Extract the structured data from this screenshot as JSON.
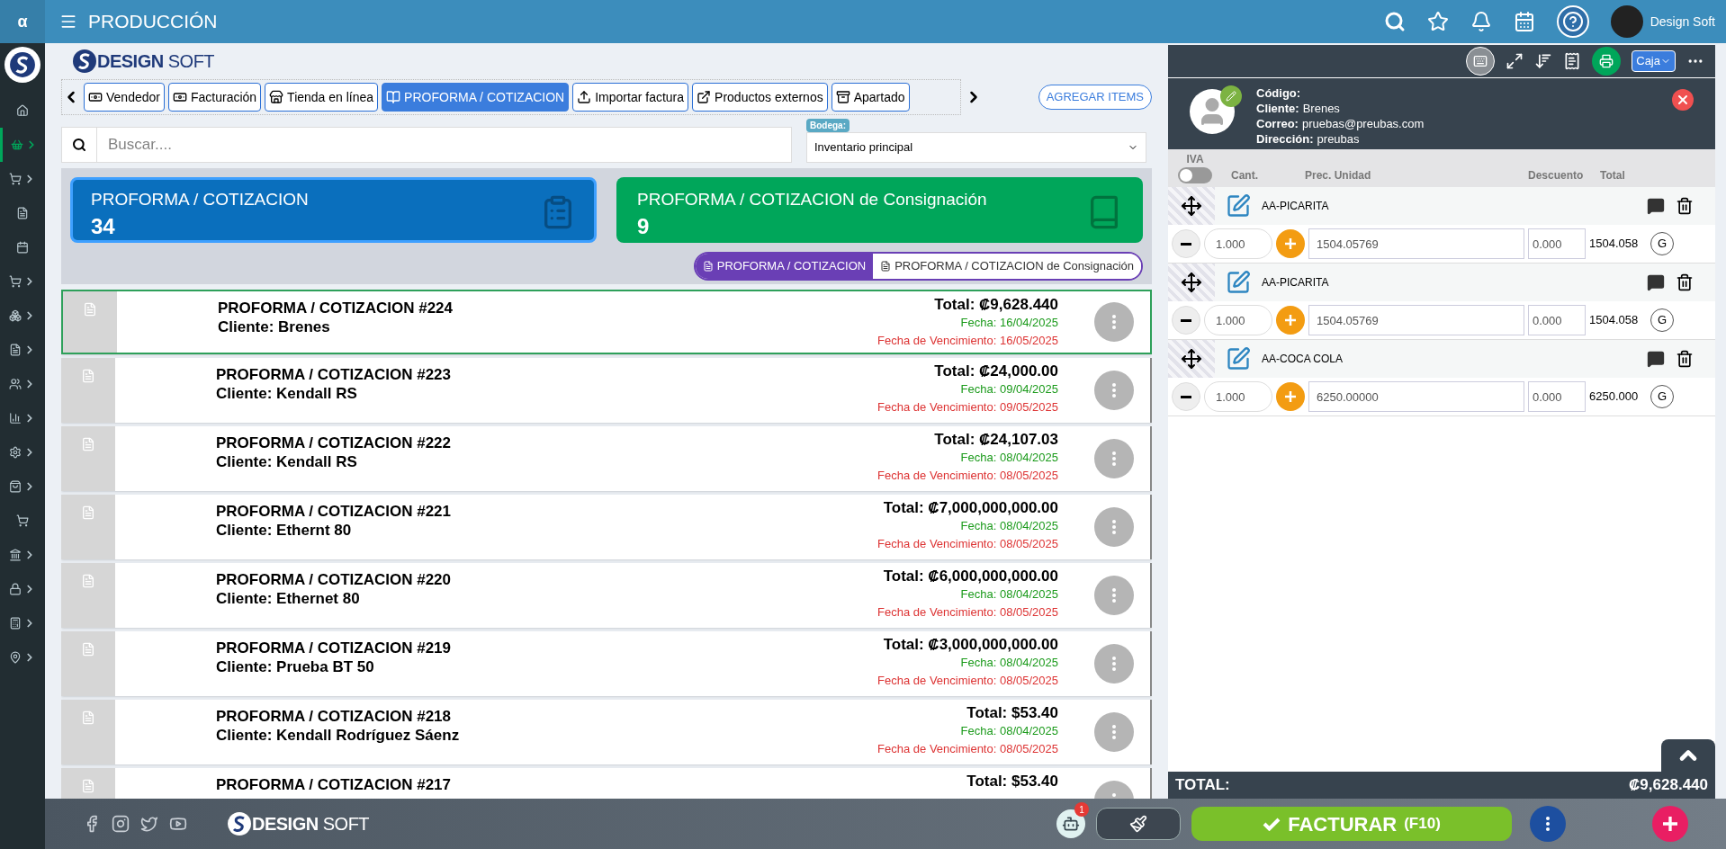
{
  "top_bar": {
    "logo": "α",
    "title": "PRODUCCIÓN",
    "user": "Design Soft"
  },
  "sidebar": {
    "items": [
      {
        "selected": false,
        "expandable": false
      },
      {
        "selected": true,
        "expandable": true
      },
      {
        "selected": false,
        "expandable": true
      },
      {
        "selected": false,
        "expandable": false
      },
      {
        "selected": false,
        "expandable": false
      },
      {
        "selected": false,
        "expandable": true
      },
      {
        "selected": false,
        "expandable": true
      },
      {
        "selected": false,
        "expandable": true
      },
      {
        "selected": false,
        "expandable": true
      },
      {
        "selected": false,
        "expandable": true
      },
      {
        "selected": false,
        "expandable": true
      },
      {
        "selected": false,
        "expandable": true
      },
      {
        "selected": false,
        "expandable": false
      },
      {
        "selected": false,
        "expandable": true
      },
      {
        "selected": false,
        "expandable": true
      },
      {
        "selected": false,
        "expandable": true
      },
      {
        "selected": false,
        "expandable": true
      }
    ]
  },
  "brand": {
    "bold": "DESIGN",
    "light": "SOFT"
  },
  "footer_brand": {
    "bold": "DESIGN",
    "light": "SOFT"
  },
  "tabs": [
    {
      "label": "Vendedor",
      "selected": false
    },
    {
      "label": "Facturación",
      "selected": false
    },
    {
      "label": "Tienda en línea",
      "selected": false
    },
    {
      "label": "PROFORMA / COTIZACION",
      "selected": true
    },
    {
      "label": "Importar factura",
      "selected": false
    },
    {
      "label": "Productos externos",
      "selected": false
    },
    {
      "label": "Apartado",
      "selected": false
    }
  ],
  "add_button": "AGREGAR ITEMS",
  "search": {
    "placeholder": "Buscar...."
  },
  "warehouse": {
    "label": "Bodega:",
    "value": "Inventario principal"
  },
  "summary_cards": [
    {
      "title": "PROFORMA / COTIZACION",
      "count": "34",
      "selected": true,
      "color": "#0a6fbd"
    },
    {
      "title": "PROFORMA / COTIZACION de Consignación",
      "count": "9",
      "selected": false,
      "color": "#00a65a"
    }
  ],
  "view_toggle": [
    {
      "label": "PROFORMA / COTIZACION",
      "selected": true
    },
    {
      "label": "PROFORMA / COTIZACION de Consignación",
      "selected": false
    }
  ],
  "documents": [
    {
      "title": "PROFORMA / COTIZACION #224",
      "client": "Cliente: Brenes",
      "total": "Total: ₡9,628.440",
      "date": "Fecha: 16/04/2025",
      "due": "Fecha de Vencimiento: 16/05/2025",
      "selected": true
    },
    {
      "title": "PROFORMA / COTIZACION #223",
      "client": "Cliente: Kendall RS",
      "total": "Total: ₡24,000.00",
      "date": "Fecha: 09/04/2025",
      "due": "Fecha de Vencimiento: 09/05/2025",
      "selected": false
    },
    {
      "title": "PROFORMA / COTIZACION #222",
      "client": "Cliente: Kendall RS",
      "total": "Total: ₡24,107.03",
      "date": "Fecha: 08/04/2025",
      "due": "Fecha de Vencimiento: 08/05/2025",
      "selected": false
    },
    {
      "title": "PROFORMA / COTIZACION #221",
      "client": "Cliente: Ethernt 80",
      "total": "Total: ₡7,000,000,000.00",
      "date": "Fecha: 08/04/2025",
      "due": "Fecha de Vencimiento: 08/05/2025",
      "selected": false
    },
    {
      "title": "PROFORMA / COTIZACION #220",
      "client": "Cliente: Ethernet 80",
      "total": "Total: ₡6,000,000,000.00",
      "date": "Fecha: 08/04/2025",
      "due": "Fecha de Vencimiento: 08/05/2025",
      "selected": false
    },
    {
      "title": "PROFORMA / COTIZACION #219",
      "client": "Cliente: Prueba BT 50",
      "total": "Total: ₡3,000,000,000.00",
      "date": "Fecha: 08/04/2025",
      "due": "Fecha de Vencimiento: 08/05/2025",
      "selected": false
    },
    {
      "title": "PROFORMA / COTIZACION #218",
      "client": "Cliente: Kendall Rodríguez Sáenz",
      "total": "Total: $53.40",
      "date": "Fecha: 08/04/2025",
      "due": "Fecha de Vencimiento: 08/05/2025",
      "selected": false
    },
    {
      "title": "PROFORMA / COTIZACION #217",
      "total": "Total: $53.40",
      "selected": false
    }
  ],
  "order_panel": {
    "register_button": "Caja",
    "customer": [
      {
        "label": "Código:"
      },
      {
        "label": "Cliente:",
        "value": "Brenes"
      },
      {
        "label": "Correo:",
        "value": "pruebas@preubas.com"
      },
      {
        "label": "Dirección:",
        "value": "preubas"
      }
    ],
    "iva": {
      "label": "IVA",
      "on": false
    },
    "columns": [
      "Cant.",
      "Prec. Unidad",
      "Descuento",
      "Total"
    ],
    "items": [
      {
        "name": "AA-PICARITA",
        "quantity": "1.000",
        "unit_price": "1504.05769",
        "discount": "0.000",
        "total": "1504.058",
        "tax": "G"
      },
      {
        "name": "AA-PICARITA",
        "quantity": "1.000",
        "unit_price": "1504.05769",
        "discount": "0.000",
        "total": "1504.058",
        "tax": "G"
      },
      {
        "name": "AA-COCA COLA",
        "quantity": "1.000",
        "unit_price": "6250.00000",
        "discount": "0.000",
        "total": "6250.000",
        "tax": "G"
      }
    ],
    "total": {
      "label": "TOTAL:",
      "value": "₡9,628.440"
    }
  },
  "bottom_bar": {
    "notification_count": "1",
    "invoice_button": "FACTURAR",
    "shortcut": "(F10)"
  }
}
